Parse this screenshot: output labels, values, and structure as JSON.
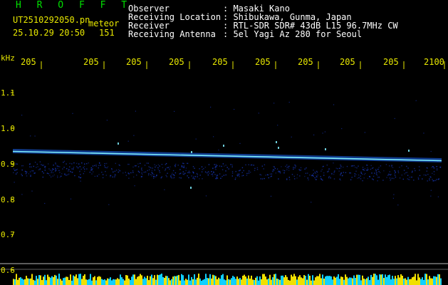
{
  "header": {
    "brand": "H R O F F T",
    "filename": "UT2510292050.pn",
    "detection_type": "meteor",
    "datetime": "25.10.29 20:50",
    "count": "151"
  },
  "info": [
    {
      "label": "Observer",
      "value": ": Masaki Kano"
    },
    {
      "label": "Receiving Location",
      "value": ": Shibukawa, Gunma, Japan"
    },
    {
      "label": "Receiver",
      "value": ": RTL-SDR SDR# 43dB L15 96.7MHz CW"
    },
    {
      "label": "Receiving Antenna",
      "value": ": 5el Yagi Az 280 for Seoul"
    }
  ],
  "x_axis": {
    "tick_labels": [
      "205",
      "205",
      "205",
      "205",
      "205",
      "205",
      "205",
      "205",
      "205",
      "2100"
    ]
  },
  "y_axis": {
    "unit": "kHz",
    "tick_labels": [
      "1.1",
      "1.0",
      "0.9",
      "0.8",
      "0.7",
      "0.6"
    ]
  },
  "colors": {
    "background": "#000000",
    "brand": "#00e000",
    "axis_text": "#e8e800",
    "info_text": "#ffffff",
    "signal_core": "#7ff0ff",
    "signal_glow": "#1e6cff",
    "noise": "#1a3cc8",
    "baseline": "#b8b8b8",
    "bottom_noise_a": "#f0e000",
    "bottom_noise_b": "#10d0ff"
  }
}
